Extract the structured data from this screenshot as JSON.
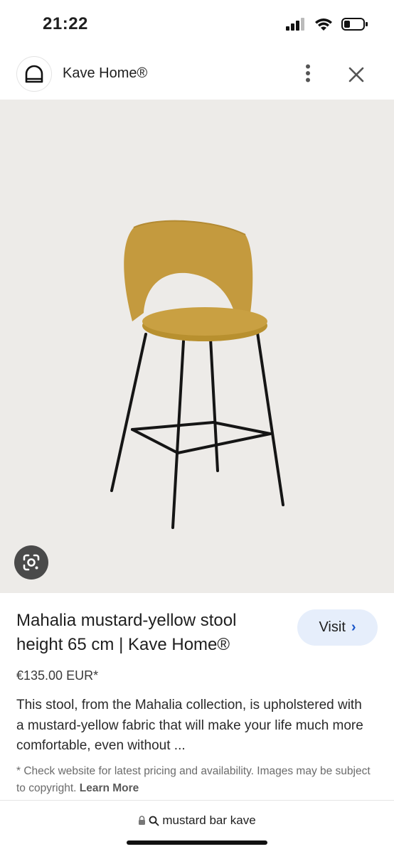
{
  "status_bar": {
    "time": "21:22"
  },
  "header": {
    "site_name": "Kave Home®"
  },
  "product": {
    "title": "Mahalia mustard-yellow stool height 65 cm | Kave Home®",
    "price": "€135.00 EUR*",
    "description": "This stool, from the Mahalia collection, is upholstered with a mustard-yellow fabric that will make your life much more comfortable, even without ...",
    "visit_label": "Visit",
    "disclaimer": "* Check website for latest pricing and availability. Images may be subject to copyright.",
    "learn_more": "Learn More"
  },
  "colors": {
    "image_background": "#edebe8",
    "seat_fabric": "#c49a3e",
    "visit_button_bg": "#e6eefb",
    "visit_chevron": "#1a56c9"
  },
  "address_bar": {
    "query": "mustard bar kave"
  },
  "icons": [
    "signal-icon",
    "wifi-icon",
    "battery-icon",
    "site-logo-icon",
    "more-vert-icon",
    "close-icon",
    "google-lens-icon",
    "lock-icon",
    "search-icon",
    "chevron-right-icon"
  ]
}
